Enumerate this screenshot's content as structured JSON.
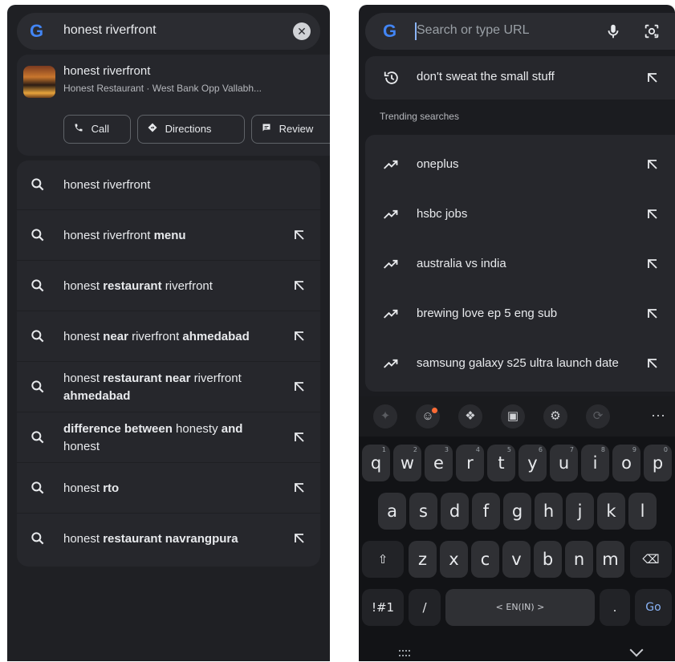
{
  "left": {
    "search_query": "honest riverfront",
    "place": {
      "title": "honest riverfront",
      "subtitle": "Honest Restaurant · West Bank Opp Vallabh...",
      "actions": [
        {
          "label": "Call",
          "icon": "phone-icon"
        },
        {
          "label": "Directions",
          "icon": "directions-icon"
        },
        {
          "label": "Review",
          "icon": "review-icon"
        }
      ]
    },
    "suggestions": [
      {
        "parts": [
          {
            "t": "honest riverfront",
            "b": false
          }
        ],
        "has_arrow": false
      },
      {
        "parts": [
          {
            "t": "honest riverfront ",
            "b": false
          },
          {
            "t": "menu",
            "b": true
          }
        ],
        "has_arrow": true
      },
      {
        "parts": [
          {
            "t": "honest ",
            "b": false
          },
          {
            "t": "restaurant",
            "b": true
          },
          {
            "t": " riverfront",
            "b": false
          }
        ],
        "has_arrow": true
      },
      {
        "parts": [
          {
            "t": "honest ",
            "b": false
          },
          {
            "t": "near",
            "b": true
          },
          {
            "t": " riverfront ",
            "b": false
          },
          {
            "t": "ahmedabad",
            "b": true
          }
        ],
        "has_arrow": true
      },
      {
        "parts": [
          {
            "t": "honest ",
            "b": false
          },
          {
            "t": "restaurant near",
            "b": true
          },
          {
            "t": " riverfront ",
            "b": false
          },
          {
            "t": "ahmedabad",
            "b": true
          }
        ],
        "has_arrow": true
      },
      {
        "parts": [
          {
            "t": "difference between",
            "b": true
          },
          {
            "t": " honesty ",
            "b": false
          },
          {
            "t": "and",
            "b": true
          },
          {
            "t": " honest",
            "b": false
          }
        ],
        "has_arrow": true
      },
      {
        "parts": [
          {
            "t": "honest ",
            "b": false
          },
          {
            "t": "rto",
            "b": true
          }
        ],
        "has_arrow": true
      },
      {
        "parts": [
          {
            "t": "honest ",
            "b": false
          },
          {
            "t": "restaurant navrangpura",
            "b": true
          }
        ],
        "has_arrow": true
      }
    ]
  },
  "right": {
    "placeholder": "Search or type URL",
    "history": {
      "label": "don't sweat the small stuff"
    },
    "trending_header": "Trending searches",
    "trending": [
      {
        "label": "oneplus"
      },
      {
        "label": "hsbc jobs"
      },
      {
        "label": "australia vs india"
      },
      {
        "label": "brewing love ep 5 eng sub"
      },
      {
        "label": "samsung galaxy s25 ultra launch date"
      }
    ],
    "keyboard": {
      "toolbar": [
        "sparkle-icon",
        "emoji-icon",
        "sticker-icon",
        "clipboard-icon",
        "settings-icon",
        "translate-icon"
      ],
      "more": "···",
      "row1": [
        {
          "k": "q",
          "h": "1"
        },
        {
          "k": "w",
          "h": "2"
        },
        {
          "k": "e",
          "h": "3"
        },
        {
          "k": "r",
          "h": "4"
        },
        {
          "k": "t",
          "h": "5"
        },
        {
          "k": "y",
          "h": "6"
        },
        {
          "k": "u",
          "h": "7"
        },
        {
          "k": "i",
          "h": "8"
        },
        {
          "k": "o",
          "h": "9"
        },
        {
          "k": "p",
          "h": "0"
        }
      ],
      "row2": [
        "a",
        "s",
        "d",
        "f",
        "g",
        "h",
        "j",
        "k",
        "l"
      ],
      "row3": [
        "z",
        "x",
        "c",
        "v",
        "b",
        "n",
        "m"
      ],
      "sym_label": "!#1",
      "slash": "/",
      "space_label": "<  EN(IN)  >",
      "period": ".",
      "go_label": "Go",
      "shift": "⇧",
      "backspace": "⌫"
    }
  }
}
